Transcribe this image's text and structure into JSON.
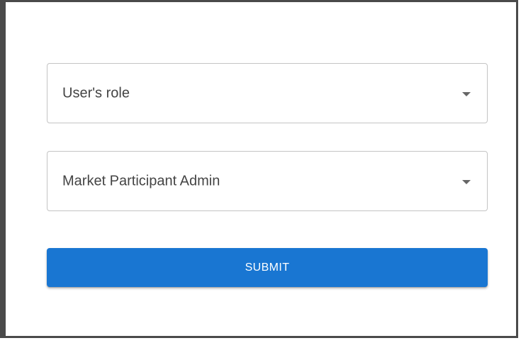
{
  "form": {
    "role_select": {
      "value": "User's role"
    },
    "market_participant_select": {
      "value": "Market Participant Admin"
    },
    "submit_label": "SUBMIT"
  },
  "colors": {
    "primary": "#1976d2",
    "border": "#c4c4c4",
    "frame": "#4a4a4a"
  },
  "icons": {
    "dropdown": "arrow-drop-down-icon"
  }
}
